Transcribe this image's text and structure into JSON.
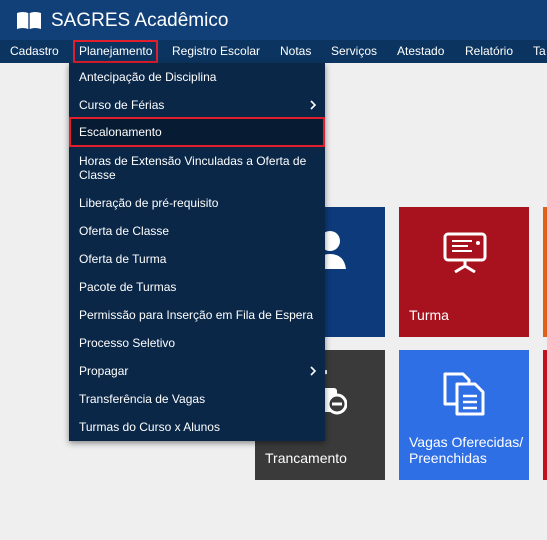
{
  "app": {
    "title": "SAGRES Acadêmico"
  },
  "menu": {
    "items": [
      {
        "label": "Cadastro"
      },
      {
        "label": "Planejamento"
      },
      {
        "label": "Registro Escolar"
      },
      {
        "label": "Notas"
      },
      {
        "label": "Serviços"
      },
      {
        "label": "Atestado"
      },
      {
        "label": "Relatório"
      },
      {
        "label": "Ta"
      }
    ],
    "active": "Planejamento"
  },
  "dropdown": {
    "items": [
      {
        "label": "Antecipação de Disciplina",
        "has_submenu": false
      },
      {
        "label": "Curso de Férias",
        "has_submenu": true
      },
      {
        "label": "Escalonamento",
        "has_submenu": false,
        "highlighted": true
      },
      {
        "label": "Horas de Extensão Vinculadas a Oferta de Classe",
        "has_submenu": false
      },
      {
        "label": "Liberação de pré-requisito",
        "has_submenu": false
      },
      {
        "label": "Oferta de Classe",
        "has_submenu": false
      },
      {
        "label": "Oferta de Turma",
        "has_submenu": false
      },
      {
        "label": "Pacote de Turmas",
        "has_submenu": false
      },
      {
        "label": "Permissão para Inserção em Fila de Espera",
        "has_submenu": false
      },
      {
        "label": "Processo Seletivo",
        "has_submenu": false
      },
      {
        "label": "Propagar",
        "has_submenu": true
      },
      {
        "label": "Transferência de Vagas",
        "has_submenu": false
      },
      {
        "label": "Turmas do Curso x Alunos",
        "has_submenu": false
      }
    ]
  },
  "tiles": [
    {
      "label": "",
      "icon": "user-icon",
      "color": "#0d3a7a"
    },
    {
      "label": "Turma",
      "icon": "presentation-board-icon",
      "color": "#a8121e"
    },
    {
      "label": "",
      "icon": "",
      "color": "#e0601a"
    },
    {
      "label": "Trancamento",
      "icon": "lock-minus-icon",
      "color": "#3a3a3a"
    },
    {
      "label": "Vagas Oferecidas/ Preenchidas",
      "icon": "documents-icon",
      "color": "#2f6fe6"
    },
    {
      "label": "",
      "icon": "",
      "color": "#c0111d"
    }
  ],
  "colors": {
    "header": "#114079",
    "menubar": "#0b3560",
    "dropdown": "#0a2748",
    "highlight_outline": "#e01e2c",
    "background": "#efeff0"
  }
}
